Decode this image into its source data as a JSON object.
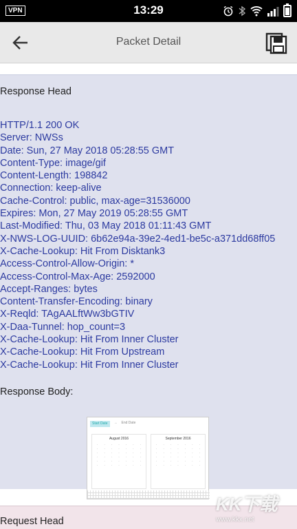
{
  "status_bar": {
    "vpn_label": "VPN",
    "time": "13:29",
    "icons": [
      "alarm-icon",
      "bluetooth-icon",
      "wifi-icon",
      "signal-icon",
      "battery-icon"
    ]
  },
  "app_bar": {
    "title": "Packet Detail",
    "back_icon": "back-arrow-icon",
    "save_icon": "save-icon"
  },
  "response_head": {
    "title": "Response Head",
    "lines": [
      "HTTP/1.1 200 OK",
      "Server: NWSs",
      "Date: Sun, 27 May 2018 05:28:55 GMT",
      "Content-Type: image/gif",
      "Content-Length: 198842",
      "Connection: keep-alive",
      "Cache-Control: public, max-age=31536000",
      "Expires: Mon, 27 May 2019 05:28:55 GMT",
      "Last-Modified: Thu, 03 May 2018 01:11:43 GMT",
      "X-NWS-LOG-UUID: 6b62e94a-39e2-4ed1-be5c-a371dd68ff05",
      "X-Cache-Lookup: Hit From Disktank3",
      "Access-Control-Allow-Origin: *",
      "Access-Control-Max-Age: 2592000",
      "Accept-Ranges: bytes",
      "Content-Transfer-Encoding: binary",
      "X-Reqld: TAgAALftWw3bGTIV",
      "X-Daa-Tunnel: hop_count=3",
      "X-Cache-Lookup: Hit From Inner Cluster",
      "X-Cache-Lookup: Hit From Upstream",
      "X-Cache-Lookup: Hit From Inner Cluster"
    ]
  },
  "response_body": {
    "title": "Response Body:",
    "preview": {
      "start_label": "Start Date",
      "end_label": "End Date",
      "month_left": "August 2016",
      "month_right": "September 2016"
    }
  },
  "request_head": {
    "title": "Request Head"
  },
  "watermark": {
    "logo_text": "KK下载",
    "url": "www.kkx.net"
  },
  "colors": {
    "status_bar": "#000000",
    "app_bar": "#e9e9e9",
    "response_panel": "#dfe1ee",
    "header_text": "#2c3aa0",
    "request_panel": "#f2e4ea"
  }
}
